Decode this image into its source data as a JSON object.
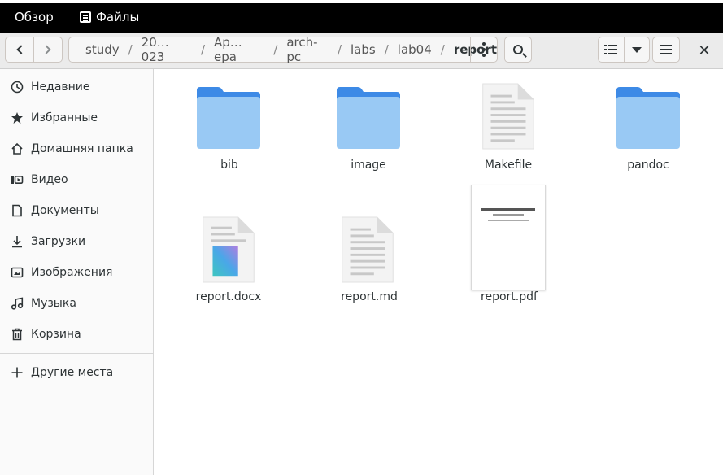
{
  "topbar": {
    "overview": "Обзор",
    "app_name": "Файлы"
  },
  "pathbar": {
    "crumbs": [
      "study",
      "20… 023",
      "Ар… ера",
      "arch-pc",
      "labs",
      "lab04",
      "report"
    ]
  },
  "sidebar": {
    "items": [
      {
        "label": "Недавние",
        "icon": "clock-icon"
      },
      {
        "label": "Избранные",
        "icon": "star-icon"
      },
      {
        "label": "Домашняя папка",
        "icon": "home-icon"
      },
      {
        "label": "Видео",
        "icon": "video-icon"
      },
      {
        "label": "Документы",
        "icon": "document-icon"
      },
      {
        "label": "Загрузки",
        "icon": "download-icon"
      },
      {
        "label": "Изображения",
        "icon": "image-icon"
      },
      {
        "label": "Музыка",
        "icon": "music-icon"
      },
      {
        "label": "Корзина",
        "icon": "trash-icon"
      }
    ],
    "other_places": "Другие места"
  },
  "files": [
    {
      "name": "bib",
      "type": "folder"
    },
    {
      "name": "image",
      "type": "folder"
    },
    {
      "name": "Makefile",
      "type": "text"
    },
    {
      "name": "pandoc",
      "type": "folder"
    },
    {
      "name": "report.docx",
      "type": "docx"
    },
    {
      "name": "report.md",
      "type": "text"
    },
    {
      "name": "report.pdf",
      "type": "pdf"
    }
  ],
  "colors": {
    "folder_top": "#3d8ae6",
    "folder_front": "#99c9f4",
    "accent": "#3584e4"
  }
}
